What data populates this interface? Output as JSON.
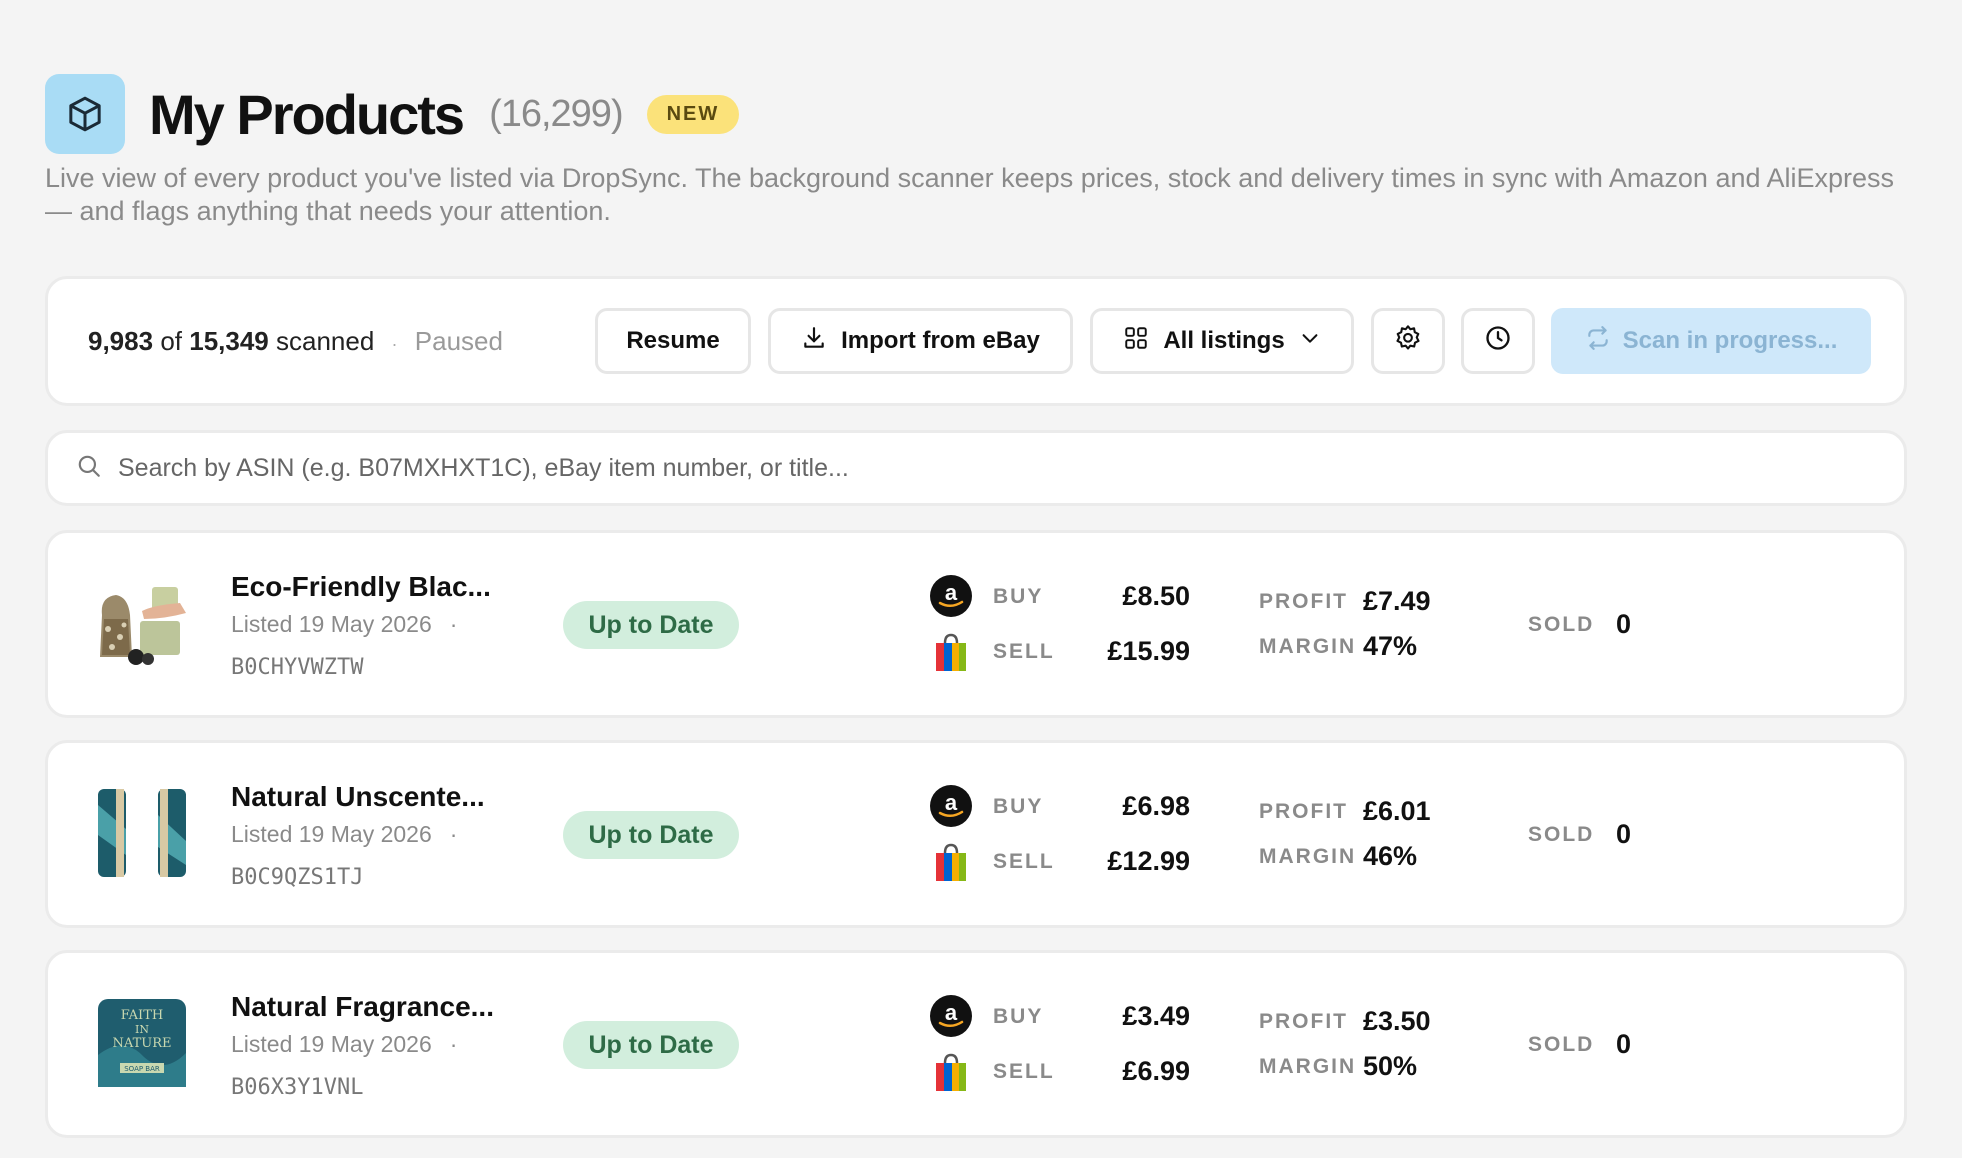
{
  "header": {
    "title": "My Products",
    "count": "(16,299)",
    "badge": "NEW",
    "subtitle": "Live view of every product you've listed via DropSync. The background scanner keeps prices, stock and delivery times in sync with Amazon and AliExpress — and flags anything that needs your attention."
  },
  "toolbar": {
    "scanned_count": "9,983",
    "of_label": "of",
    "total": "15,349",
    "scanned_label": "scanned",
    "separator": "·",
    "status": "Paused",
    "resume_label": "Resume",
    "import_label": "Import from eBay",
    "listings_label": "All listings",
    "scan_label": "Scan in progress..."
  },
  "search": {
    "placeholder": "Search by ASIN (e.g. B07MXHXT1C), eBay item number, or title..."
  },
  "labels": {
    "buy": "BUY",
    "sell": "SELL",
    "profit": "PROFIT",
    "margin": "MARGIN",
    "sold": "SOLD",
    "dot": "·"
  },
  "products": [
    {
      "title": "Eco-Friendly Blac...",
      "listed": "Listed 19 May 2026",
      "asin": "B0CHYVWZTW",
      "status": "Up to Date",
      "buy": "£8.50",
      "sell": "£15.99",
      "profit": "£7.49",
      "margin": "47%",
      "sold": "0"
    },
    {
      "title": "Natural Unscente...",
      "listed": "Listed 19 May 2026",
      "asin": "B0C9QZS1TJ",
      "status": "Up to Date",
      "buy": "£6.98",
      "sell": "£12.99",
      "profit": "£6.01",
      "margin": "46%",
      "sold": "0"
    },
    {
      "title": "Natural Fragrance...",
      "listed": "Listed 19 May 2026",
      "asin": "B06X3Y1VNL",
      "status": "Up to Date",
      "buy": "£3.49",
      "sell": "£6.99",
      "profit": "£3.50",
      "margin": "50%",
      "sold": "0"
    }
  ],
  "thumb3_text": [
    "FAITH",
    "IN",
    "NATURE",
    "SOAP BAR"
  ],
  "colors": {
    "accent_blue": "#a9dcf5",
    "badge_yellow": "#fbe27a",
    "status_green_bg": "#d2eedd",
    "status_green_text": "#2e6b46",
    "scan_button_bg": "#cfe8fa"
  }
}
